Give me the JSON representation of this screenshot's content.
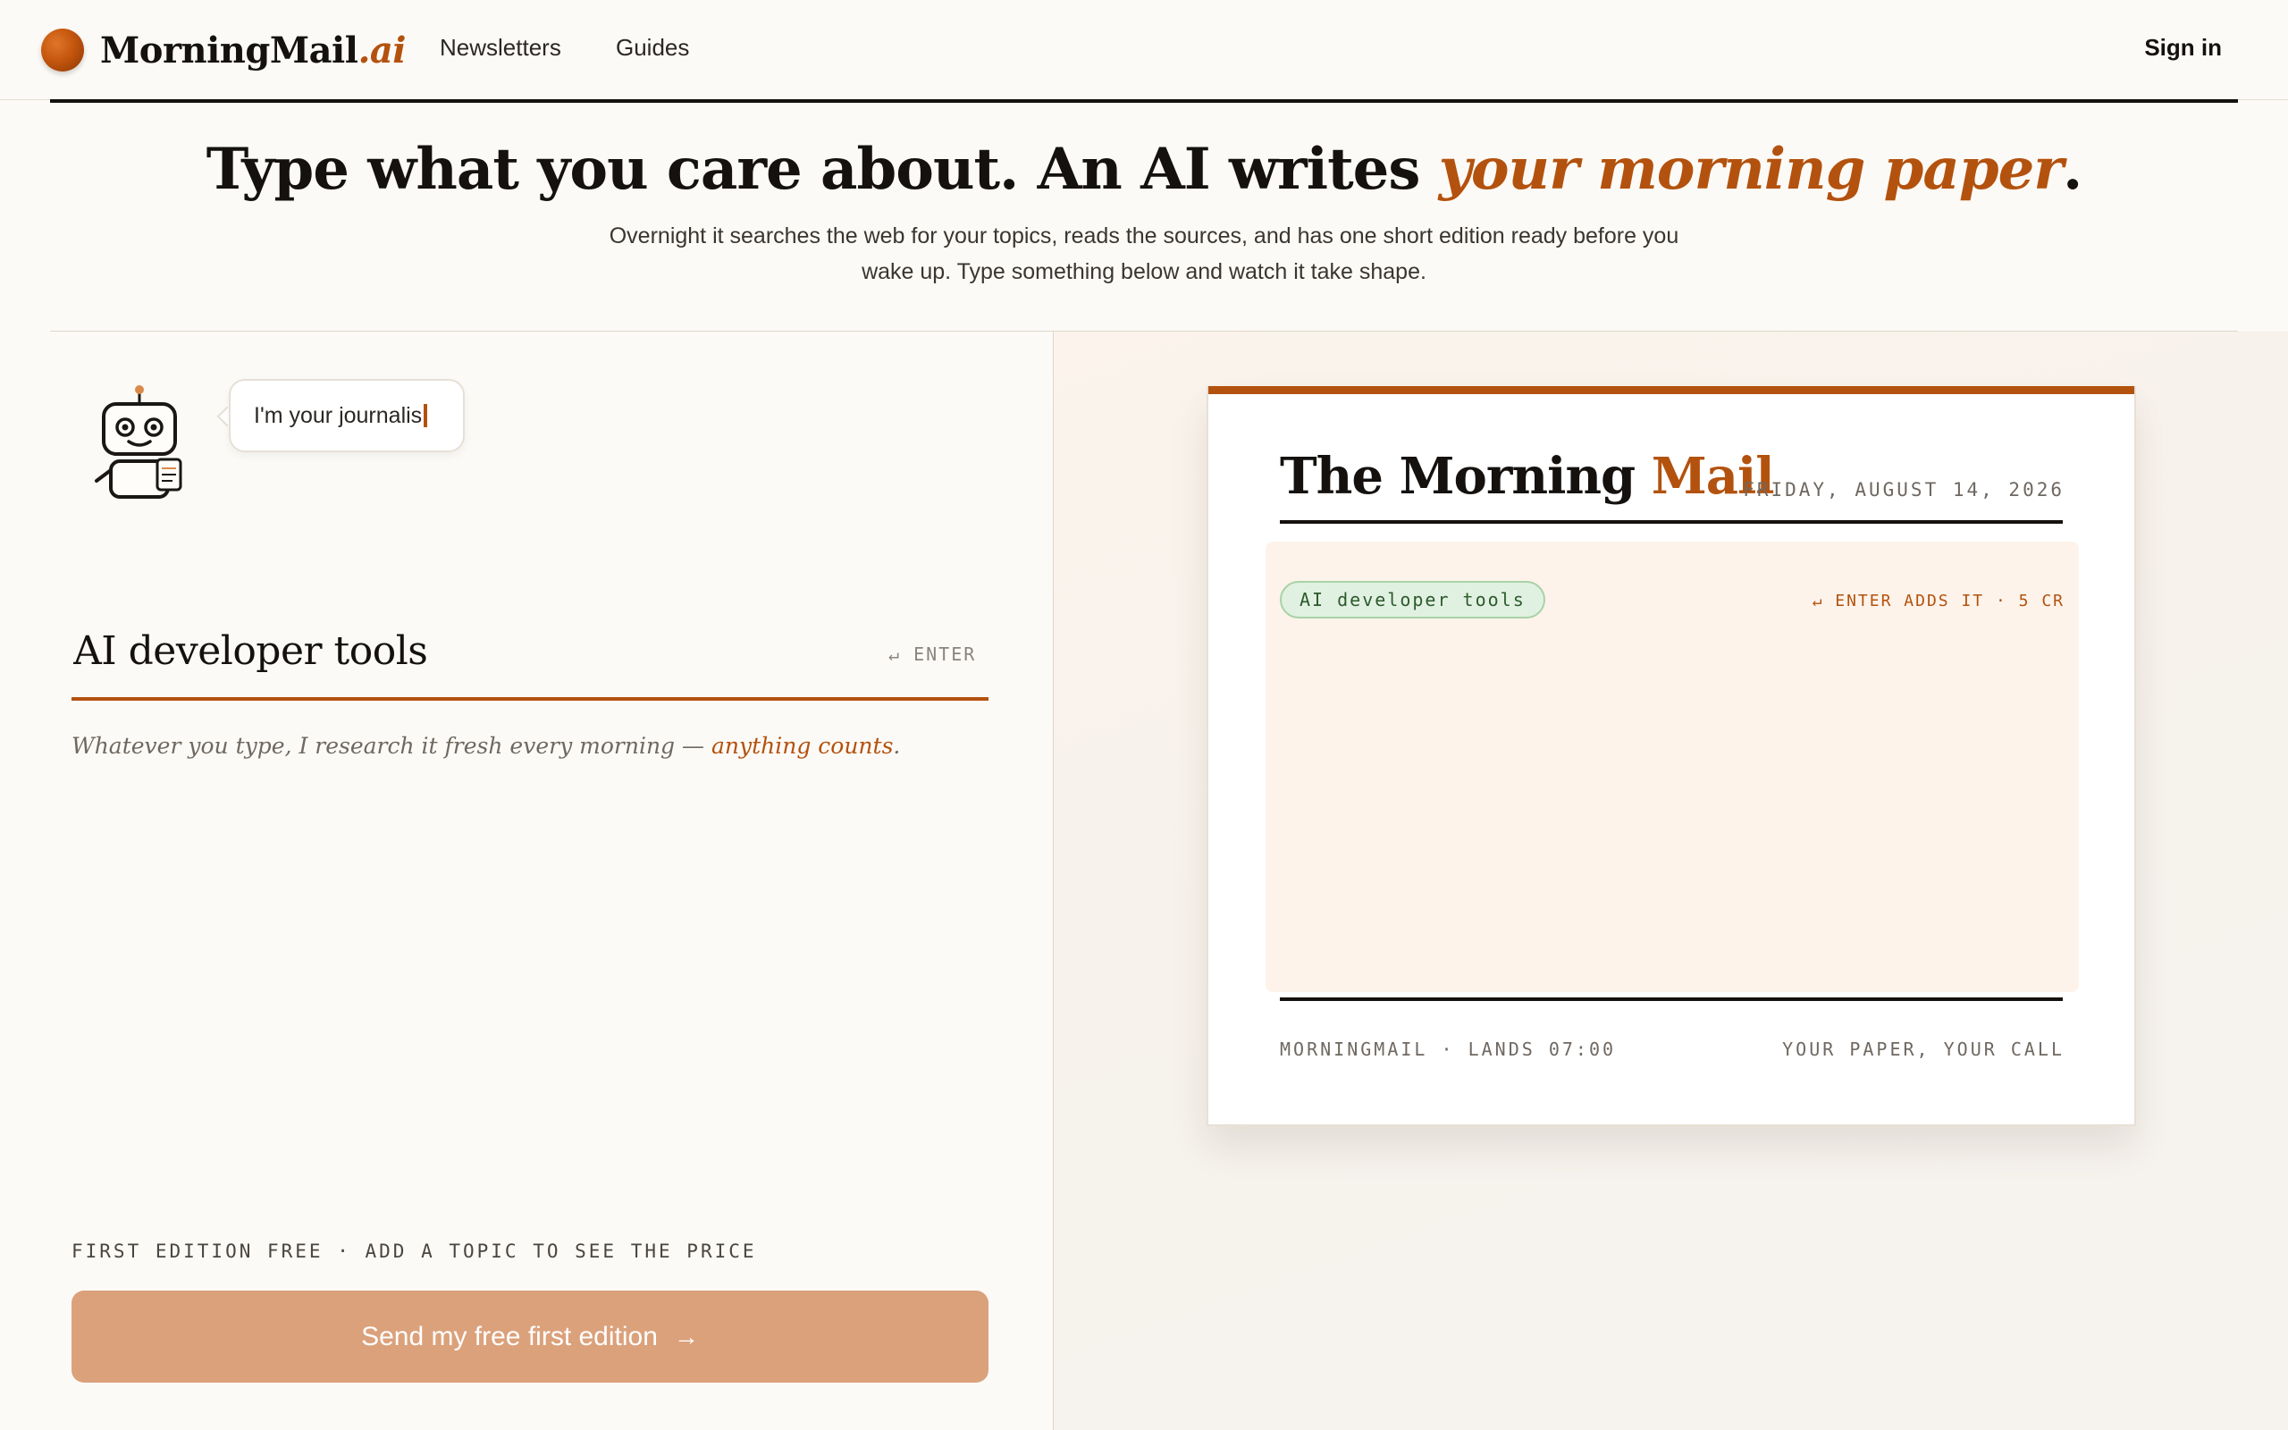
{
  "nav": {
    "brand_name": "MorningMail",
    "brand_suffix": ".ai",
    "links": [
      "Newsletters",
      "Guides"
    ],
    "sign_in": "Sign in"
  },
  "hero": {
    "title_main": "Type what you care about. An AI writes ",
    "title_accent": "your morning paper",
    "title_end": ".",
    "subtitle": "Overnight it searches the web for your topics, reads the sources, and has one short edition ready before you wake up. Type something below and watch it take shape."
  },
  "assistant": {
    "bubble_text": "I'm your journalis",
    "icon": "robot-journalist-icon"
  },
  "topic": {
    "value": "AI developer tools",
    "enter_hint": "↵ ENTER",
    "helper_text": "Whatever you type, I research it fresh every morning — ",
    "helper_link": "anything counts",
    "helper_end": "."
  },
  "pricing": {
    "note": "FIRST EDITION FREE · ADD A TOPIC TO SEE THE PRICE",
    "cta_label": "Send my free first edition",
    "cta_arrow": "→"
  },
  "preview": {
    "title_main": "The Morning ",
    "title_accent": "Mail",
    "date": "FRIDAY, AUGUST 14, 2026",
    "chip": "AI developer tools",
    "body_hint": "↵ ENTER ADDS IT · 5 CR",
    "footer_left": "MORNINGMAIL · LANDS 07:00",
    "footer_right": "YOUR PAPER, YOUR CALL"
  },
  "colors": {
    "accent": "#b3520e",
    "background": "#fcfaf6",
    "cta": "#dba17b",
    "chip_bg": "#e1f1e1"
  }
}
